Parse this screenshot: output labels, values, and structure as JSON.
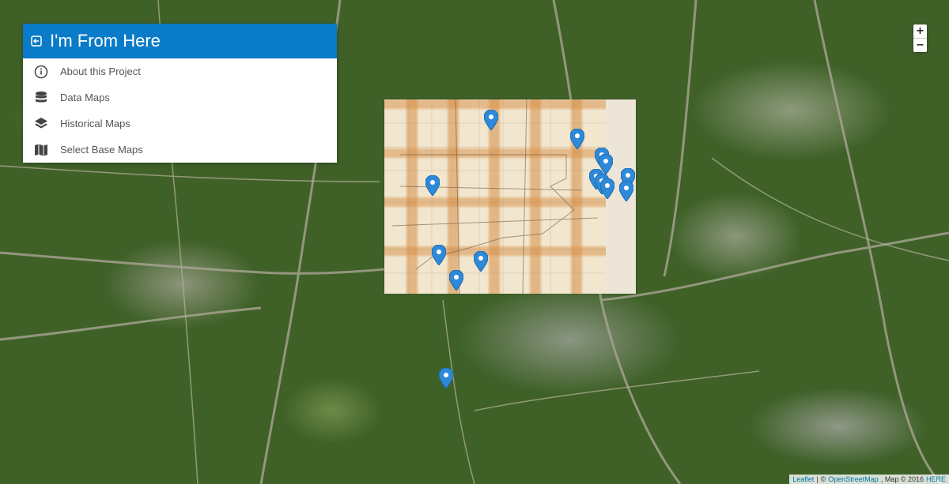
{
  "panel": {
    "title": "I'm From Here",
    "menu": [
      {
        "label": "About this Project",
        "icon": "info-icon"
      },
      {
        "label": "Data Maps",
        "icon": "database-icon"
      },
      {
        "label": "Historical Maps",
        "icon": "layers-icon"
      },
      {
        "label": "Select Base Maps",
        "icon": "map-icon"
      }
    ]
  },
  "zoom": {
    "in_label": "+",
    "out_label": "−"
  },
  "attribution": {
    "leaflet": "Leaflet",
    "sep": "|",
    "osm_prefix": "©",
    "osm": "OpenStreetMap",
    "map_text": ", Map © 2016",
    "here": "HERE"
  },
  "colors": {
    "accent": "#0a7bc8",
    "marker": "#2e8ad8",
    "satellite": "#3f6128",
    "overlay_paper": "#f2e6cf",
    "overlay_stain": "#d68f46"
  }
}
